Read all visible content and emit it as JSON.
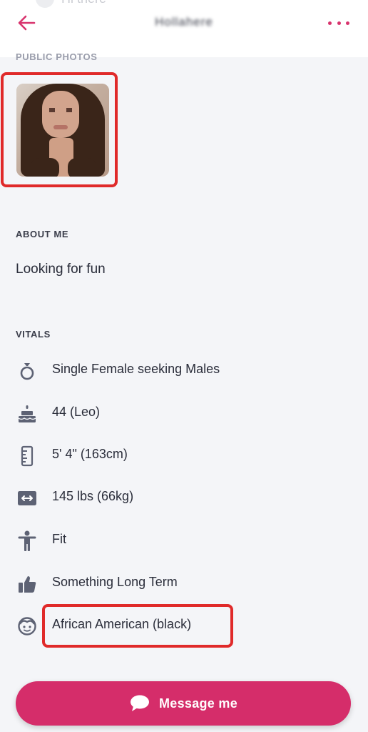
{
  "header": {
    "ghost_text": "Hi there",
    "title": "Hollahere"
  },
  "photos": {
    "section_label": "PUBLIC PHOTOS"
  },
  "about": {
    "section_label": "ABOUT ME",
    "text": "Looking for fun"
  },
  "vitals": {
    "section_label": "VITALS",
    "items": [
      {
        "icon": "ring-icon",
        "text": "Single Female seeking Males"
      },
      {
        "icon": "cake-icon",
        "text": "44 (Leo)"
      },
      {
        "icon": "ruler-icon",
        "text": "5' 4\" (163cm)"
      },
      {
        "icon": "weight-icon",
        "text": "145 lbs (66kg)"
      },
      {
        "icon": "body-icon",
        "text": "Fit"
      },
      {
        "icon": "thumbs-up-icon",
        "text": "Something Long Term"
      },
      {
        "icon": "face-icon",
        "text": "African American (black)"
      }
    ]
  },
  "cta": {
    "message_label": "Message me"
  },
  "colors": {
    "accent": "#d52d6a",
    "highlight": "#e02a2a",
    "icon": "#5d6274"
  }
}
